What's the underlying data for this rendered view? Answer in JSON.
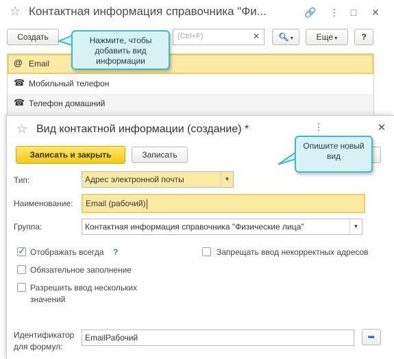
{
  "back_window": {
    "title": "Контактная информация справочника \"Фи...",
    "toolbar": {
      "create_label": "Создать",
      "search_placeholder": "(Ctrl+F)",
      "more_label": "Еще",
      "help_label": "?"
    },
    "list": [
      {
        "icon": "at-sign-icon",
        "label": "Email"
      },
      {
        "icon": "phone-icon",
        "label": "Мобильный телефон"
      },
      {
        "icon": "phone-icon",
        "label": "Телефон домашний"
      }
    ]
  },
  "dialog": {
    "title": "Вид контактной информации (создание) *",
    "buttons": {
      "save_close": "Записать и закрыть",
      "save": "Записать"
    },
    "fields": {
      "type_label": "Тип:",
      "type_value": "Адрес электронной почты",
      "name_label": "Наименование:",
      "name_value": "Email (рабочий)",
      "group_label": "Группа:",
      "group_value": "Контактная информация справочника \"Физические лица\"",
      "identifier_label_1": "Идентификатор",
      "identifier_label_2": "для формул:",
      "identifier_value": "EmailРабочий"
    },
    "checkboxes": {
      "always_show": {
        "label": "Отображать всегда",
        "checked": true,
        "help": "?"
      },
      "required": {
        "label": "Обязательное заполнение",
        "checked": false
      },
      "multiple_line1": {
        "label": "Разрешить ввод нескольких",
        "checked": false
      },
      "multiple_line2": "значений",
      "forbid_invalid": {
        "label": "Запрещать ввод некорректных адресов",
        "checked": false
      }
    }
  },
  "callouts": {
    "create_hint_1": "Нажмите, чтобы",
    "create_hint_2": "добавить вид",
    "create_hint_3": "информации",
    "describe_hint_1": "Опишите новый",
    "describe_hint_2": "вид"
  },
  "colors": {
    "accent_yellow": "#f6c913",
    "selection": "#fbeaa4",
    "callout_bg": "#d6f2f5",
    "callout_border": "#3fb9c8"
  }
}
